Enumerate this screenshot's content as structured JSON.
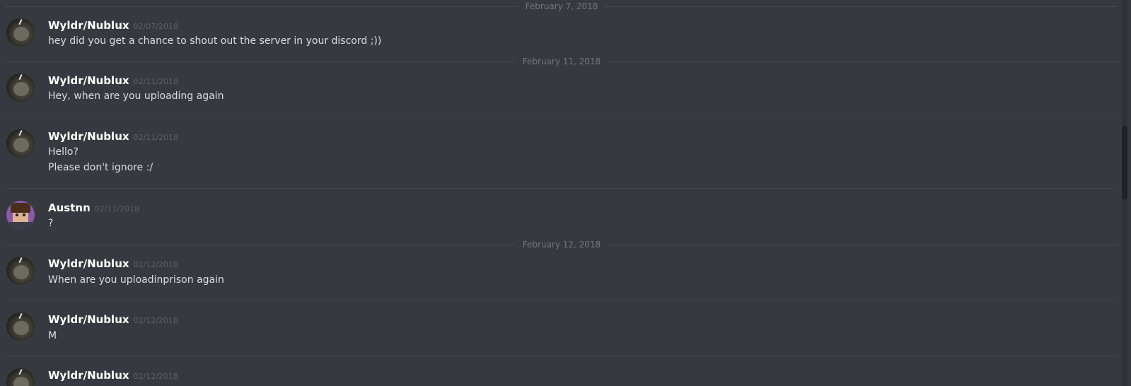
{
  "dividers": [
    "February 7, 2018",
    "February 11, 2018",
    "February 12, 2018"
  ],
  "messages": [
    {
      "author": "Wyldr/Nublux",
      "timestamp": "02/07/2018",
      "lines": [
        "hey did you get a chance to shout out the server in your discord ;))"
      ]
    },
    {
      "author": "Wyldr/Nublux",
      "timestamp": "02/11/2018",
      "lines": [
        "Hey, when are you uploading again"
      ]
    },
    {
      "author": "Wyldr/Nublux",
      "timestamp": "02/11/2018",
      "lines": [
        "Hello?",
        "Please don't ignore :/"
      ]
    },
    {
      "author": "Austnn",
      "timestamp": "02/11/2018",
      "lines": [
        "?"
      ]
    },
    {
      "author": "Wyldr/Nublux",
      "timestamp": "02/12/2018",
      "lines": [
        "When are you uploadinprison again"
      ]
    },
    {
      "author": "Wyldr/Nublux",
      "timestamp": "02/12/2018",
      "lines": [
        "M"
      ]
    },
    {
      "author": "Wyldr/Nublux",
      "timestamp": "02/12/2018",
      "lines": []
    }
  ],
  "avatars": [
    "cat-avatar",
    "cat-avatar",
    "cat-avatar",
    "character-avatar",
    "cat-avatar",
    "cat-avatar",
    "cat-avatar"
  ],
  "colors": {
    "background": "#36393f",
    "username": "#ffffff",
    "message_text": "#dcddde",
    "timestamp": "#5d6066",
    "divider_label": "#72767d"
  }
}
